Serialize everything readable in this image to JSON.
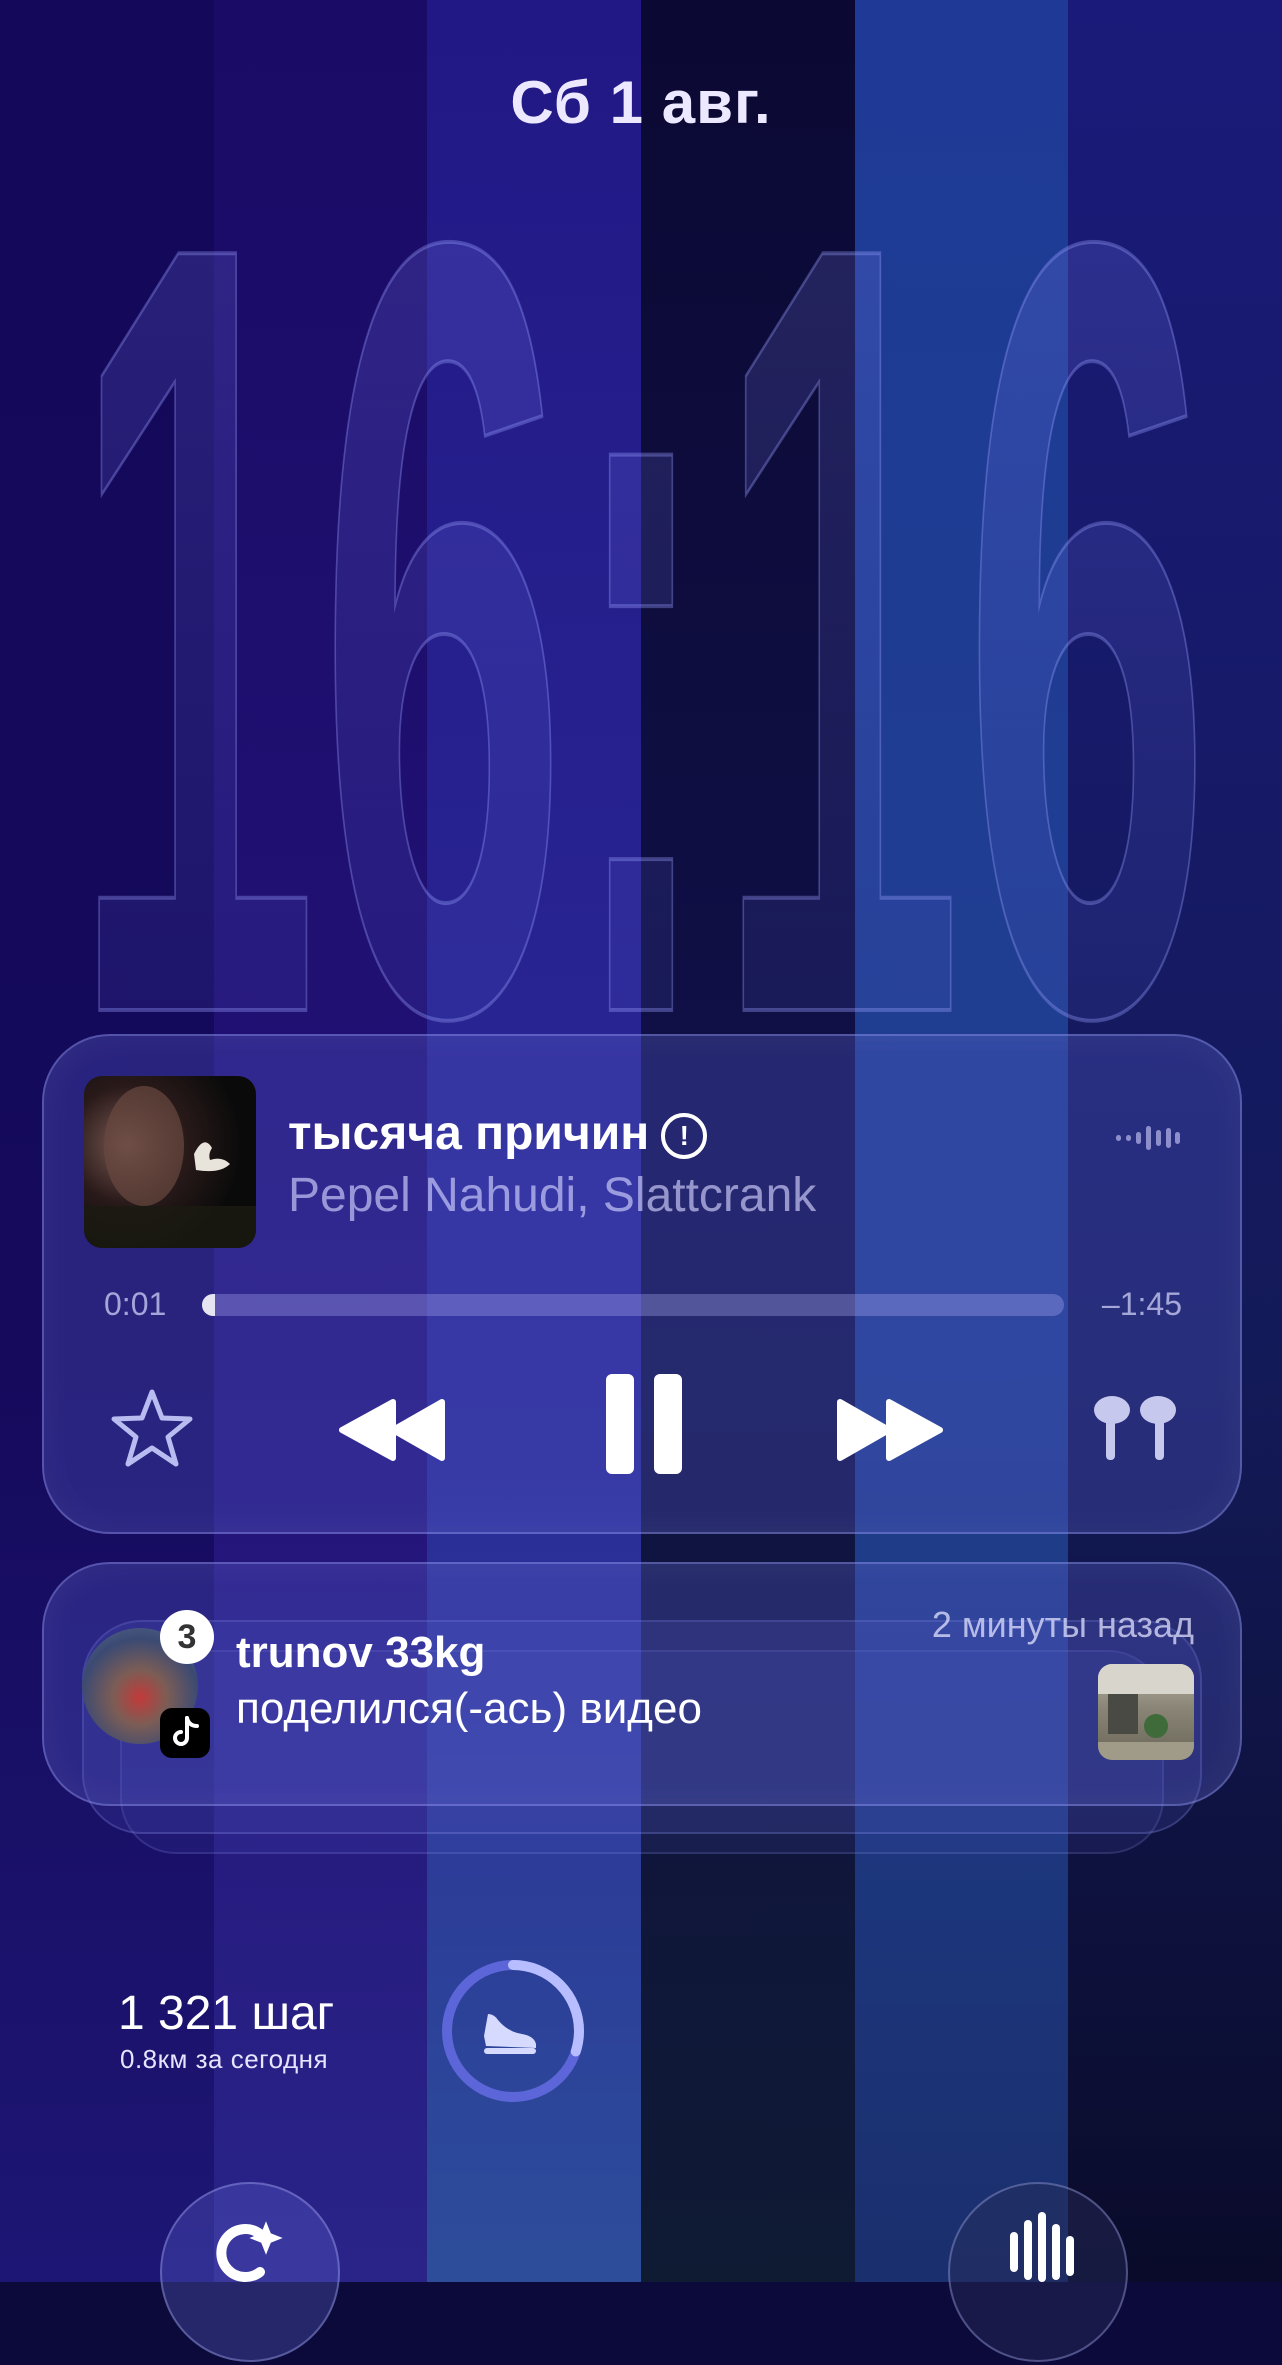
{
  "lockscreen": {
    "date": "Сб 1 авг.",
    "time": "16:16"
  },
  "now_playing": {
    "title": "тысяча причин",
    "explicit_symbol": "!",
    "artist": "Pepel Nahudi, Slattcrank",
    "elapsed": "0:01",
    "remaining": "–1:45",
    "progress": 0.01,
    "controls": [
      "favorite-star",
      "rewind",
      "pause",
      "fast-forward",
      "airpods-output"
    ]
  },
  "notification": {
    "sender": "trunov 33kg",
    "message": "поделился(-ась) видео",
    "time": "2 минуты назад",
    "count": "3",
    "app_icon": "tiktok-icon"
  },
  "widgets": {
    "steps": "1 321 шаг",
    "steps_sub": "0.8км за сегодня",
    "ring_progress": 0.3
  },
  "colors": {
    "accent_ring": "#8f9bff",
    "glass_border": "#aaaff0"
  }
}
